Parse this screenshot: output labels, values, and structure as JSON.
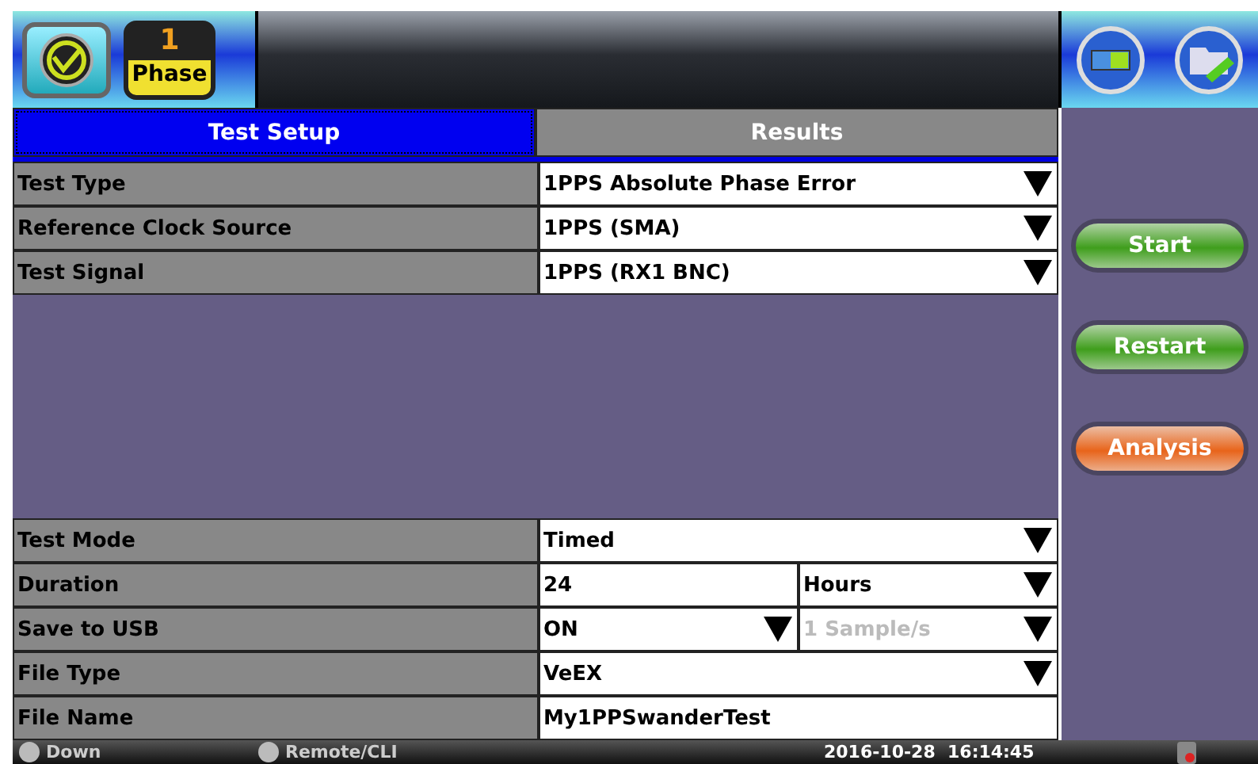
{
  "header": {
    "badge": {
      "number": "1",
      "label": "Phase"
    }
  },
  "tabs": [
    {
      "label": "Test Setup",
      "selected": true
    },
    {
      "label": "Results",
      "selected": false
    }
  ],
  "top_rows": [
    {
      "label": "Test Type",
      "fields": [
        {
          "kind": "select",
          "value": "1PPS Absolute Phase Error",
          "disabled": false
        }
      ]
    },
    {
      "label": "Reference Clock Source",
      "fields": [
        {
          "kind": "select",
          "value": "1PPS (SMA)",
          "disabled": false
        }
      ]
    },
    {
      "label": "Test Signal",
      "fields": [
        {
          "kind": "select",
          "value": "1PPS (RX1 BNC)",
          "disabled": false
        }
      ]
    }
  ],
  "bottom_rows": [
    {
      "label": "Test Mode",
      "fields": [
        {
          "kind": "select",
          "value": "Timed",
          "disabled": false
        }
      ]
    },
    {
      "label": "Duration",
      "fields": [
        {
          "kind": "input",
          "value": "24",
          "disabled": false
        },
        {
          "kind": "select",
          "value": "Hours",
          "disabled": false
        }
      ]
    },
    {
      "label": "Save to USB",
      "fields": [
        {
          "kind": "select",
          "value": "ON",
          "disabled": false
        },
        {
          "kind": "select",
          "value": "1 Sample/s",
          "disabled": true
        }
      ]
    },
    {
      "label": "File Type",
      "fields": [
        {
          "kind": "select",
          "value": "VeEX",
          "disabled": false
        }
      ]
    },
    {
      "label": "File Name",
      "fields": [
        {
          "kind": "input",
          "value": "My1PPSwanderTest",
          "disabled": false
        }
      ]
    }
  ],
  "actions": [
    {
      "label": "Start",
      "color": "#3f9e1c"
    },
    {
      "label": "Restart",
      "color": "#3f9e1c"
    },
    {
      "label": "Analysis",
      "color": "#e8641a"
    }
  ],
  "status_bar": {
    "ip": "Down",
    "remote": "Remote/CLI",
    "datetime": "2016-10-28  16:14:45"
  }
}
